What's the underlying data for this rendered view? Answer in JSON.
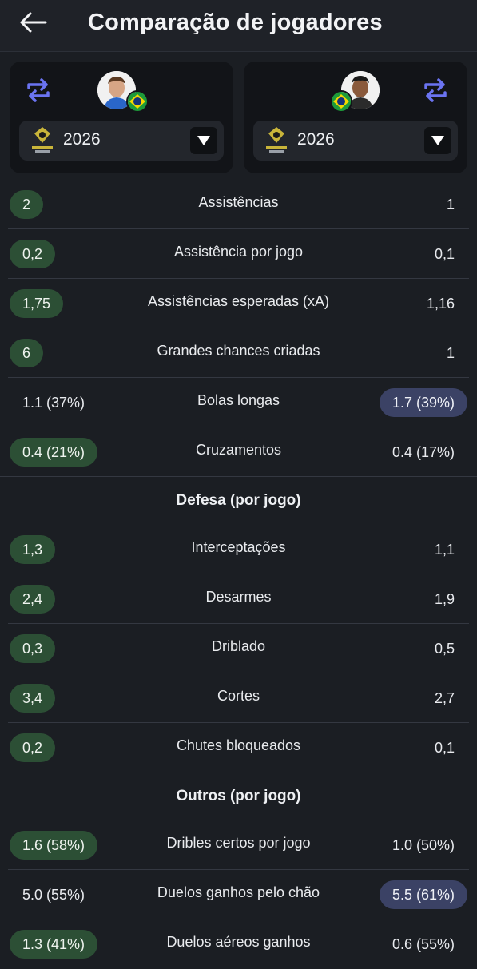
{
  "header": {
    "title": "Comparação de jogadores"
  },
  "colors": {
    "win_green": "#2c4f35",
    "win_blue": "#3b4265",
    "accent_swap": "#6b74f2"
  },
  "player_left": {
    "season": "2026",
    "league_logo": "brasileirao-betano-logo",
    "flag": "brazil-flag"
  },
  "player_right": {
    "season": "2026",
    "league_logo": "brasileirao-betano-logo",
    "flag": "brazil-flag"
  },
  "rows_attack": [
    {
      "label": "Assistências",
      "left": "2",
      "right": "1",
      "highlight": "left"
    },
    {
      "label": "Assistência por jogo",
      "left": "0,2",
      "right": "0,1",
      "highlight": "left"
    },
    {
      "label": "Assistências esperadas (xA)",
      "left": "1,75",
      "right": "1,16",
      "highlight": "left"
    },
    {
      "label": "Grandes chances criadas",
      "left": "6",
      "right": "1",
      "highlight": "left"
    },
    {
      "label": "Bolas longas",
      "left": "1.1 (37%)",
      "right": "1.7 (39%)",
      "highlight": "right"
    },
    {
      "label": "Cruzamentos",
      "left": "0.4 (21%)",
      "right": "0.4 (17%)",
      "highlight": "left"
    }
  ],
  "section_defense": "Defesa (por jogo)",
  "rows_defense": [
    {
      "label": "Interceptações",
      "left": "1,3",
      "right": "1,1",
      "highlight": "left"
    },
    {
      "label": "Desarmes",
      "left": "2,4",
      "right": "1,9",
      "highlight": "left"
    },
    {
      "label": "Driblado",
      "left": "0,3",
      "right": "0,5",
      "highlight": "left"
    },
    {
      "label": "Cortes",
      "left": "3,4",
      "right": "2,7",
      "highlight": "left"
    },
    {
      "label": "Chutes bloqueados",
      "left": "0,2",
      "right": "0,1",
      "highlight": "left"
    }
  ],
  "section_other": "Outros (por jogo)",
  "rows_other": [
    {
      "label": "Dribles certos por jogo",
      "left": "1.6 (58%)",
      "right": "1.0 (50%)",
      "highlight": "left"
    },
    {
      "label": "Duelos ganhos pelo chão",
      "left": "5.0 (55%)",
      "right": "5.5 (61%)",
      "highlight": "right"
    },
    {
      "label": "Duelos aéreos ganhos",
      "left": "1.3 (41%)",
      "right": "0.6 (55%)",
      "highlight": "left"
    }
  ]
}
